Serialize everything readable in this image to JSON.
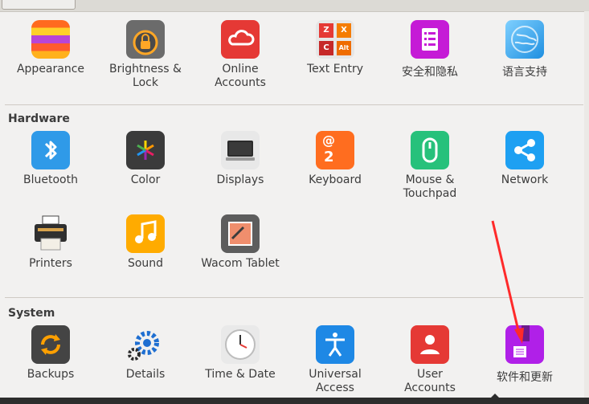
{
  "sections": {
    "hardware": "Hardware",
    "system": "System"
  },
  "personal": [
    {
      "label": "Appearance"
    },
    {
      "label": "Brightness &\nLock"
    },
    {
      "label": "Online\nAccounts"
    },
    {
      "label": "Text Entry"
    },
    {
      "label": "安全和隐私"
    },
    {
      "label": "语言支持"
    }
  ],
  "hardware": [
    {
      "label": "Bluetooth"
    },
    {
      "label": "Color"
    },
    {
      "label": "Displays"
    },
    {
      "label": "Keyboard"
    },
    {
      "label": "Mouse &\nTouchpad"
    },
    {
      "label": "Network"
    },
    {
      "label": "Printers"
    },
    {
      "label": "Sound"
    },
    {
      "label": "Wacom Tablet"
    }
  ],
  "system": [
    {
      "label": "Backups"
    },
    {
      "label": "Details"
    },
    {
      "label": "Time & Date"
    },
    {
      "label": "Universal\nAccess"
    },
    {
      "label": "User\nAccounts"
    },
    {
      "label": "软件和更新"
    }
  ],
  "icon_glyphs": {
    "text_entry": [
      "Z",
      "X",
      "C",
      "Alt"
    ],
    "keyboard": [
      "@",
      "2"
    ]
  },
  "colors": {
    "annotation_arrow": "#ff2a2a",
    "selected_icon": "#b020e8"
  }
}
